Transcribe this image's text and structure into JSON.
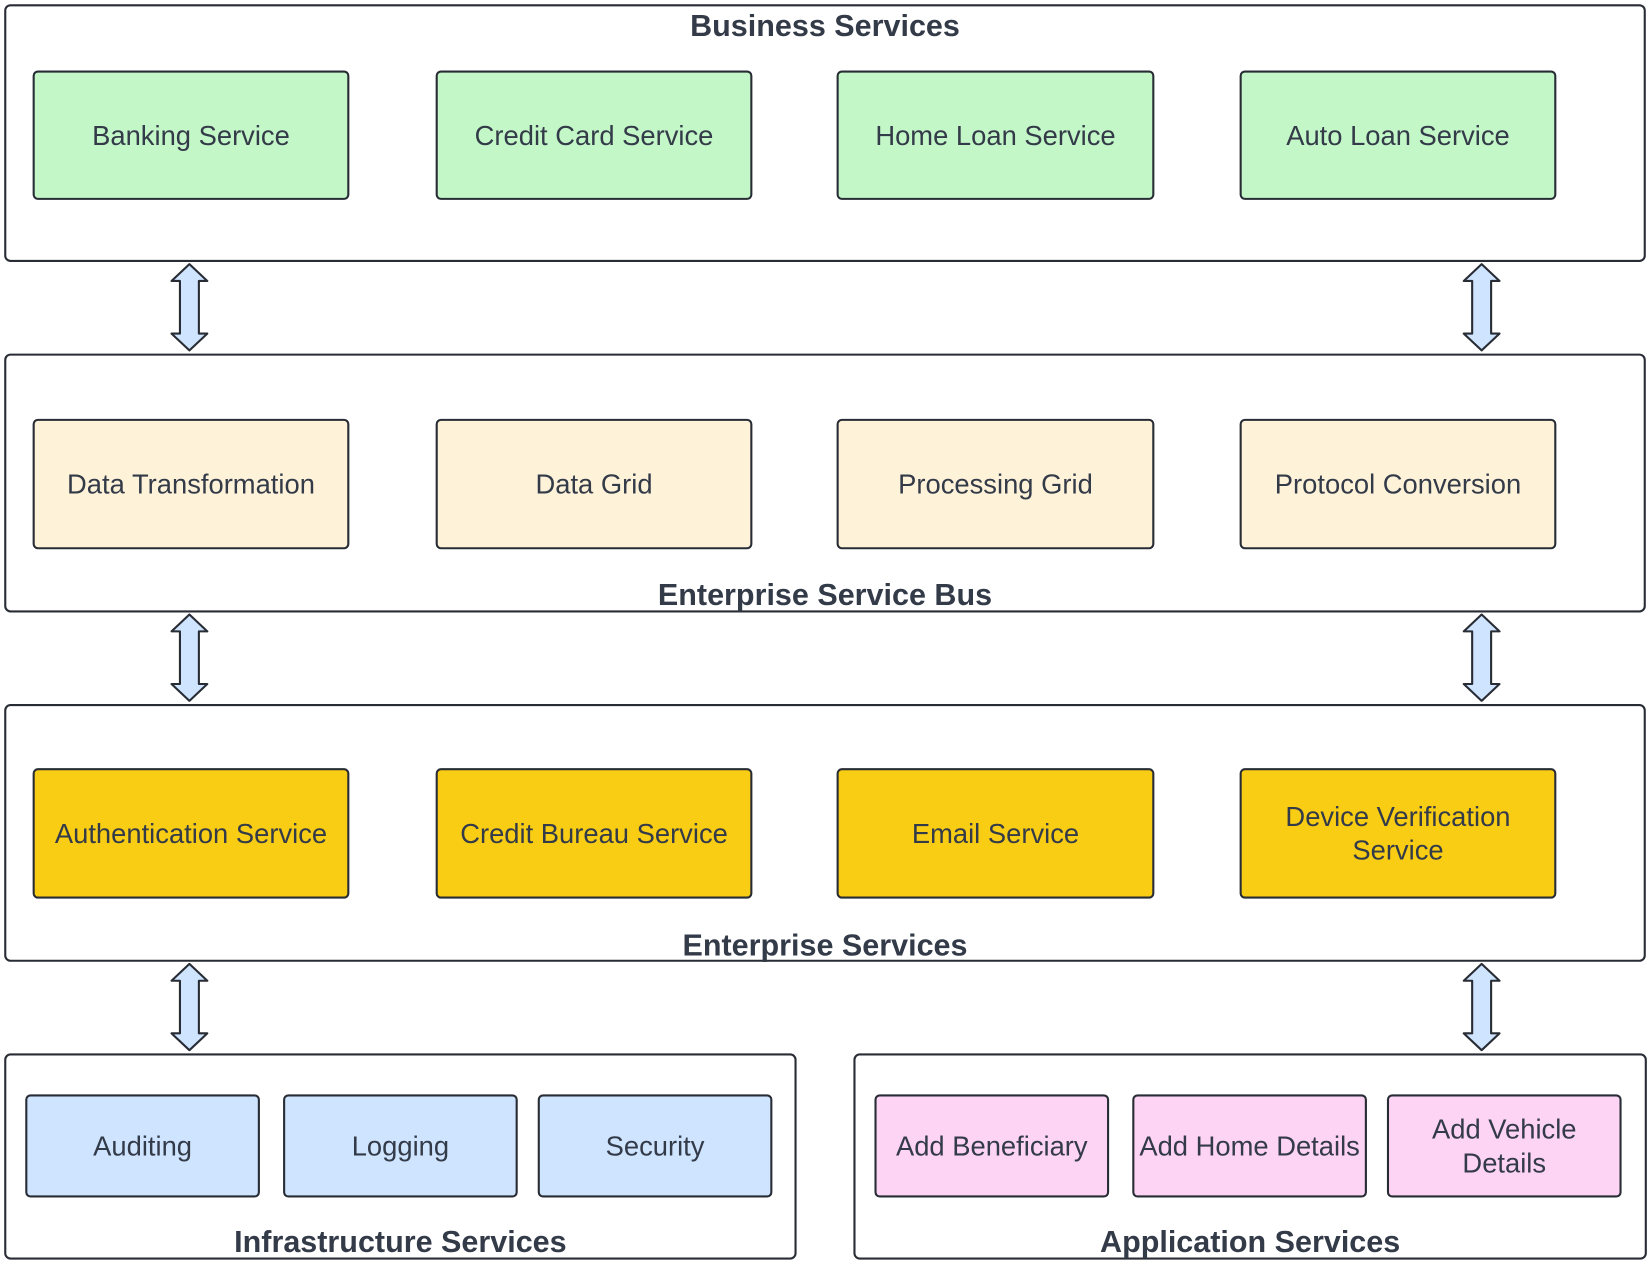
{
  "colors": {
    "business": "#c3f7c8",
    "esb": "#fef2d9",
    "enterprise": "#facd15",
    "infrastructure": "#cfe4ff",
    "application": "#fdd4f4",
    "arrow": "#cfe4ff",
    "border": "#282c34"
  },
  "layers": {
    "business": {
      "title": "Business Services",
      "items": [
        "Banking Service",
        "Credit Card Service",
        "Home Loan Service",
        "Auto Loan Service"
      ]
    },
    "esb": {
      "title": "Enterprise Service Bus",
      "items": [
        "Data Transformation",
        "Data Grid",
        "Processing Grid",
        "Protocol Conversion"
      ]
    },
    "enterprise": {
      "title": "Enterprise Services",
      "items": [
        "Authentication Service",
        "Credit Bureau Service",
        "Email Service",
        "Device Verification Service"
      ]
    },
    "infrastructure": {
      "title": "Infrastructure Services",
      "items": [
        "Auditing",
        "Logging",
        "Security"
      ]
    },
    "application": {
      "title": "Application Services",
      "items": [
        "Add Beneficiary",
        "Add Home Details",
        "Add Vehicle Details"
      ]
    }
  }
}
